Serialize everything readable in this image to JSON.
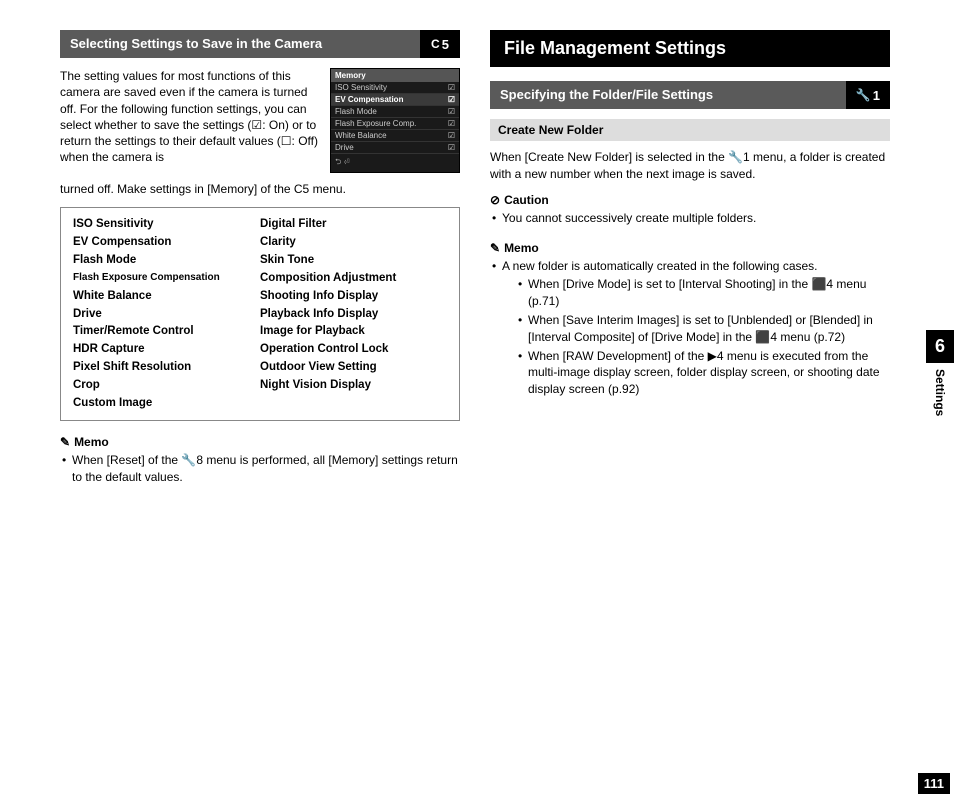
{
  "side": {
    "chapter": "6",
    "label": "Settings",
    "page": "111"
  },
  "left": {
    "header": {
      "title": "Selecting Settings to Save in the Camera",
      "tagIcon": "C",
      "tagNum": "5"
    },
    "intro_part1": "The setting values for most functions of this camera are saved even if the camera is turned off. For the following function settings, you can select whether to save the settings (☑: On) or to return the settings to their default values (☐: Off) when the camera is",
    "intro_part2": "turned off. Make settings in [Memory] of the C5 menu.",
    "screenshot": {
      "title": "Memory",
      "rows": [
        {
          "label": "ISO Sensitivity",
          "checked": true
        },
        {
          "label": "EV Compensation",
          "checked": true,
          "sel": true
        },
        {
          "label": "Flash Mode",
          "checked": true
        },
        {
          "label": "Flash Exposure Comp.",
          "checked": true
        },
        {
          "label": "White Balance",
          "checked": true
        },
        {
          "label": "Drive",
          "checked": true
        }
      ],
      "foot": "⮌ ⏎"
    },
    "grid": [
      [
        "ISO Sensitivity",
        "Digital Filter"
      ],
      [
        "EV Compensation",
        "Clarity"
      ],
      [
        "Flash Mode",
        "Skin Tone"
      ],
      [
        "Flash Exposure Compensation",
        "Composition Adjustment"
      ],
      [
        "White Balance",
        "Shooting Info Display"
      ],
      [
        "Drive",
        "Playback Info Display"
      ],
      [
        "Timer/Remote Control",
        "Image for Playback"
      ],
      [
        "HDR Capture",
        "Operation Control Lock"
      ],
      [
        "Pixel Shift Resolution",
        "Outdoor View Setting"
      ],
      [
        "Crop",
        "Night Vision Display"
      ],
      [
        "Custom Image",
        ""
      ]
    ],
    "memo": {
      "icon": "✎",
      "label": "Memo",
      "items": [
        "When [Reset] of the 🔧8 menu is performed, all [Memory] settings return to the default values."
      ]
    }
  },
  "right": {
    "mainHeader": "File Management Settings",
    "subHeader": {
      "title": "Specifying the Folder/File Settings",
      "tagIcon": "🔧",
      "tagNum": "1"
    },
    "grayStrip": "Create New Folder",
    "body": "When [Create New Folder] is selected in the 🔧1 menu, a folder is created with a new number when the next image is saved.",
    "caution": {
      "icon": "⊘",
      "label": "Caution",
      "items": [
        "You cannot successively create multiple folders."
      ]
    },
    "memo": {
      "icon": "✎",
      "label": "Memo",
      "lead": "A new folder is automatically created in the following cases.",
      "items": [
        "When [Drive Mode] is set to [Interval Shooting] in the ⬛4 menu (p.71)",
        "When [Save Interim Images] is set to [Unblended] or [Blended] in [Interval Composite] of [Drive Mode] in the ⬛4 menu (p.72)",
        "When [RAW Development] of the ▶4 menu is executed from the multi-image display screen, folder display screen, or shooting date display screen (p.92)"
      ]
    }
  }
}
